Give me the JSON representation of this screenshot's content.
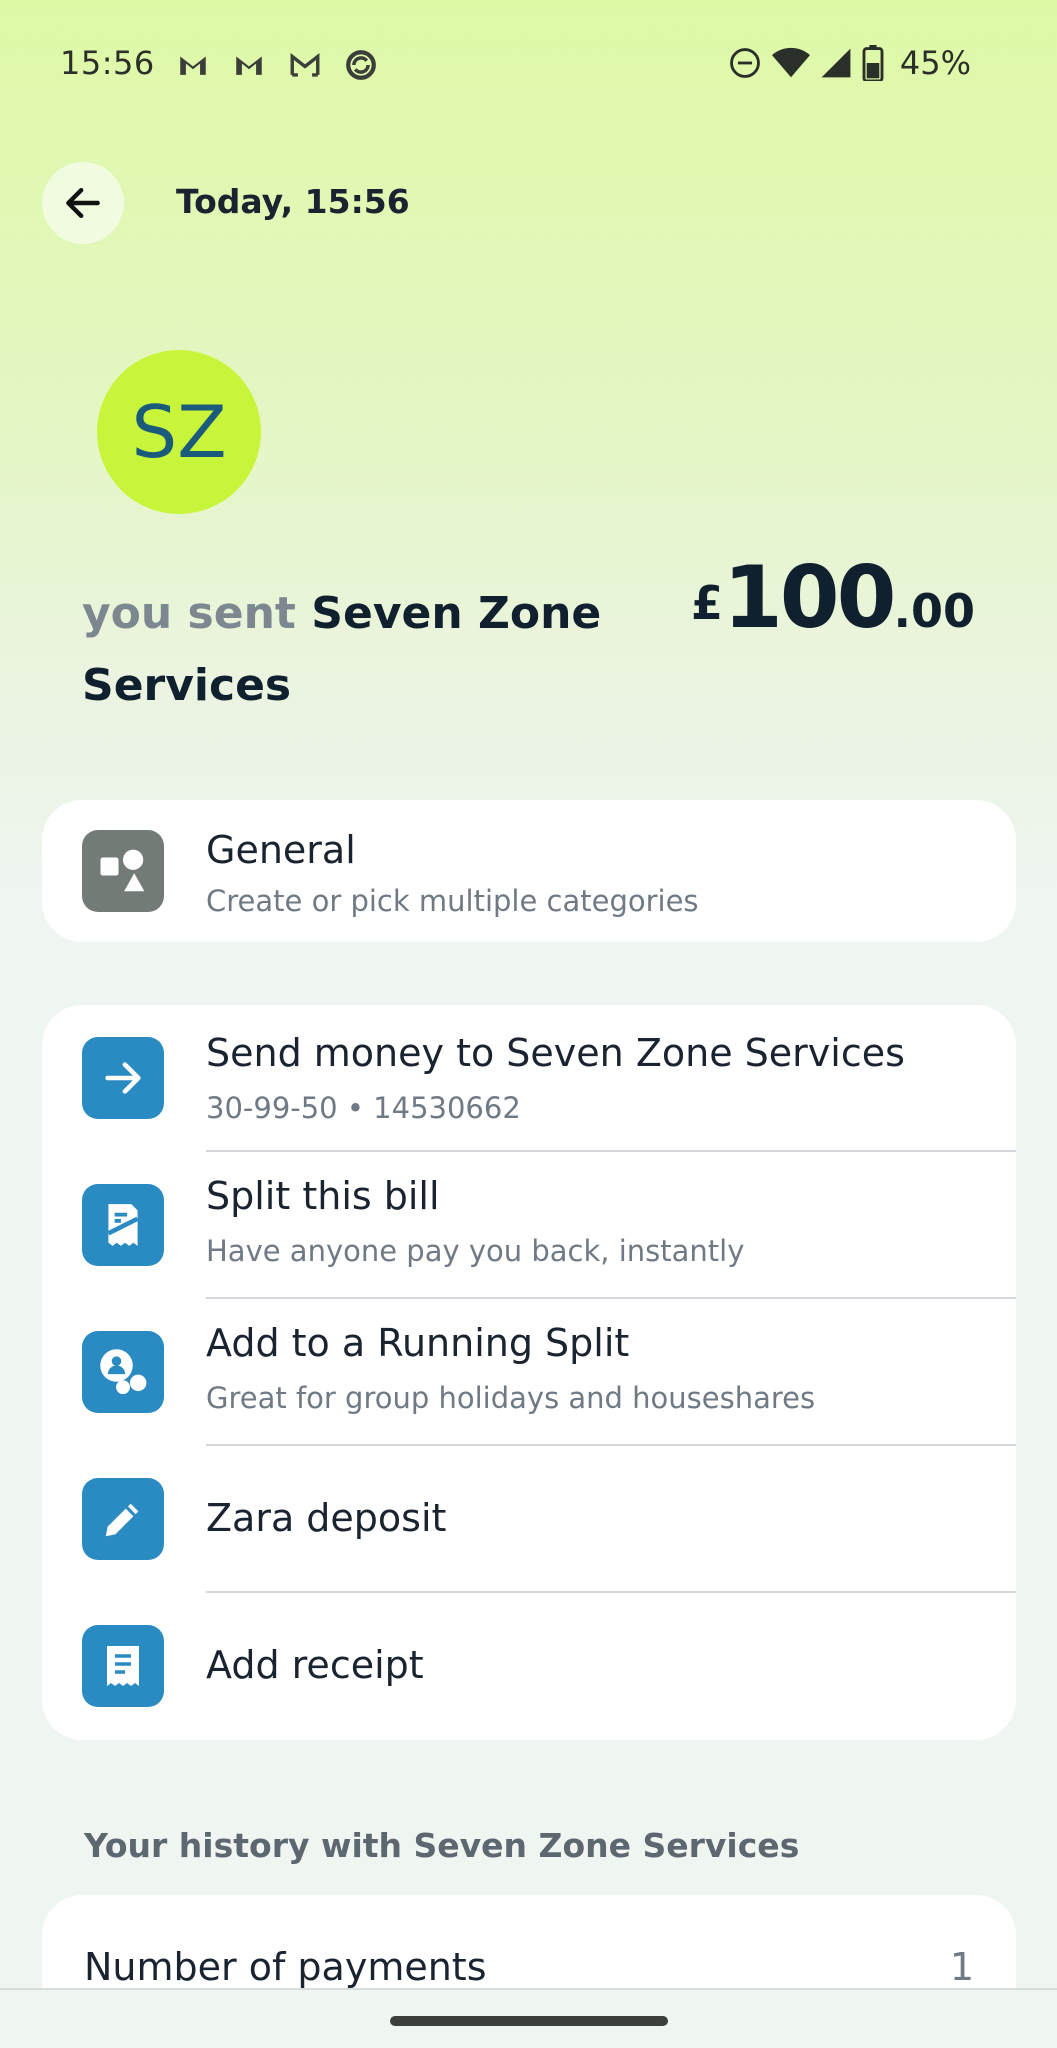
{
  "status_bar": {
    "time": "15:56",
    "notification_icons": [
      "gmail-icon",
      "gmail-icon",
      "gmail-outline-icon",
      "sync-app-icon"
    ],
    "system_icons": [
      "do-not-disturb-icon",
      "wifi-icon",
      "cell-signal-icon",
      "battery-icon"
    ],
    "battery": "45%"
  },
  "header": {
    "title": "Today, 15:56"
  },
  "transaction": {
    "avatar_initials": "SZ",
    "prefix": "you sent",
    "payee": "Seven Zone Services",
    "amount_currency": "£",
    "amount_major": "100",
    "amount_minor": ".00"
  },
  "category": {
    "title": "General",
    "subtitle": "Create or pick multiple categories"
  },
  "actions": [
    {
      "icon": "arrow-right-icon",
      "title": "Send money to Seven Zone Services",
      "subtitle": "30-99-50 • 14530662"
    },
    {
      "icon": "split-bill-icon",
      "title": "Split this bill",
      "subtitle": "Have anyone pay you back, instantly"
    },
    {
      "icon": "group-icon",
      "title": "Add to a Running Split",
      "subtitle": "Great for group holidays and houseshares"
    },
    {
      "icon": "pencil-icon",
      "title": "Zara deposit",
      "subtitle": ""
    },
    {
      "icon": "receipt-icon",
      "title": "Add receipt",
      "subtitle": ""
    }
  ],
  "history": {
    "heading": "Your history with Seven Zone Services",
    "rows": [
      {
        "label": "Number of payments",
        "value": "1"
      }
    ]
  },
  "colors": {
    "accent_blue": "#2a8bc2",
    "avatar_bg": "#c8f53a",
    "category_icon_bg": "#737b77"
  }
}
